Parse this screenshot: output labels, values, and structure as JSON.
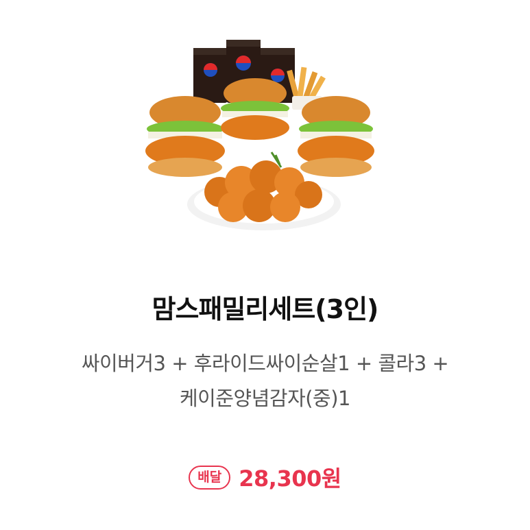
{
  "product": {
    "image_alt": "맘스패밀리세트(3인)",
    "title": "맘스패밀리세트(3인)",
    "description_line1": "싸이버거3 + 후라이드싸이순살1 + 콜라3 +",
    "description_line2": "케이준양념감자(중)1",
    "badge": "배달",
    "price": "28,300원"
  },
  "colors": {
    "accent": "#e8344e",
    "title": "#111111",
    "description": "#555555"
  }
}
